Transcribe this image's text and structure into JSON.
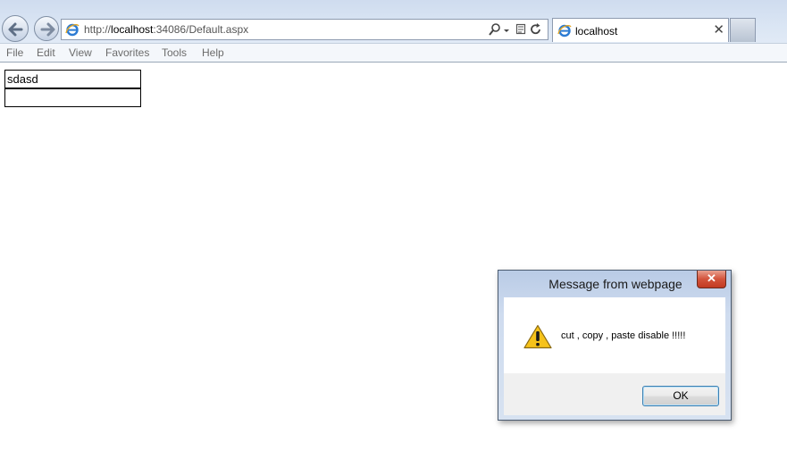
{
  "browser": {
    "address": {
      "scheme": "http://",
      "host": "localhost",
      "rest": ":34086/Default.aspx"
    },
    "tab": {
      "title": "localhost",
      "close_glyph": "✕"
    },
    "menu": [
      "File",
      "Edit",
      "View",
      "Favorites",
      "Tools",
      "Help"
    ],
    "icons": {
      "back": "back-arrow-icon",
      "forward": "forward-arrow-icon",
      "site": "ie-logo-icon",
      "search": "search-icon",
      "dropdown": "chevron-down-icon",
      "compat": "compatibility-view-icon",
      "refresh": "refresh-icon"
    }
  },
  "page": {
    "input1_value": "sdasd",
    "input2_value": ""
  },
  "dialog": {
    "title": "Message from webpage",
    "close_glyph": "✕",
    "message": "cut , copy , paste disable !!!!!",
    "ok_label": "OK",
    "icon": "warning-icon"
  },
  "colors": {
    "chrome_bg": "#dbe6f4",
    "dialog_close": "#c13a22",
    "ok_border": "#3c7fb1"
  }
}
